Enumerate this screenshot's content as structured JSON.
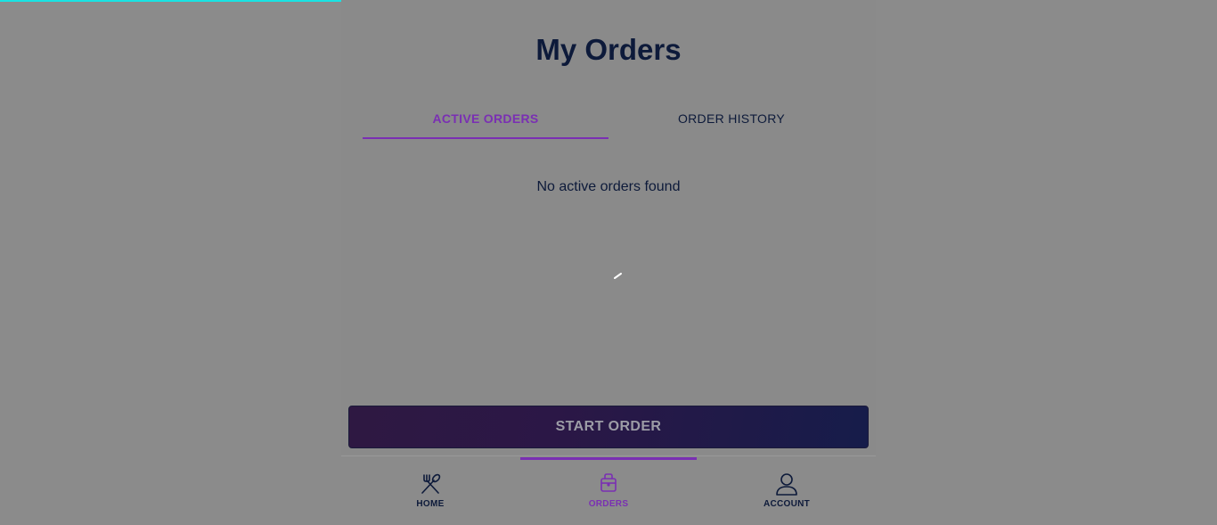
{
  "colors": {
    "accent": "#7a2fb3",
    "text_dark": "#0d1a3a",
    "progress": "#19e3e3"
  },
  "loading_progress": 0.3,
  "page": {
    "title": "My Orders"
  },
  "tabs": [
    {
      "label": "ACTIVE ORDERS",
      "active": true
    },
    {
      "label": "ORDER HISTORY",
      "active": false
    }
  ],
  "empty_state": {
    "text": "No active orders found"
  },
  "start_order": {
    "label": "START ORDER"
  },
  "bottom_nav": {
    "items": [
      {
        "label": "HOME",
        "icon": "fork-spoon-icon",
        "active": false
      },
      {
        "label": "ORDERS",
        "icon": "bag-icon",
        "active": true
      },
      {
        "label": "ACCOUNT",
        "icon": "user-icon",
        "active": false
      }
    ]
  }
}
